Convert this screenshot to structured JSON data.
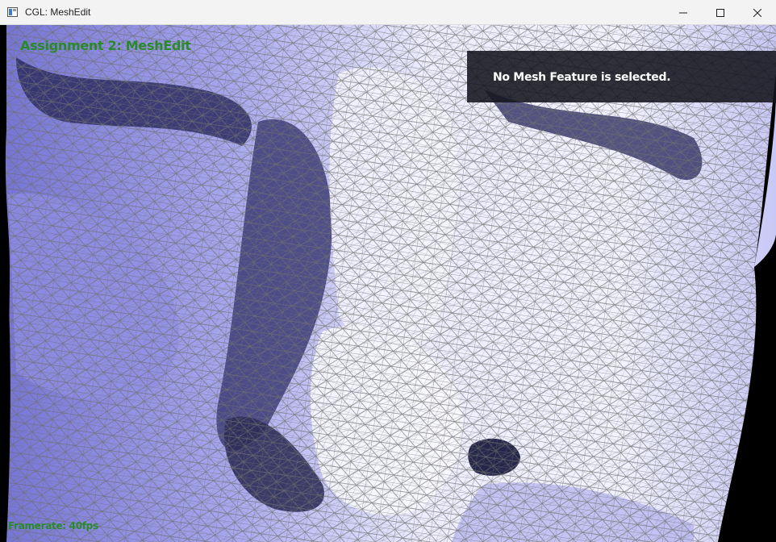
{
  "window": {
    "title": "CGL: MeshEdit",
    "controls": {
      "minimize_icon": "minimize-icon",
      "maximize_icon": "maximize-icon",
      "close_icon": "close-icon"
    }
  },
  "viewport": {
    "heading": "Assignment 2: MeshEdit",
    "info_message": "No Mesh Feature is selected.",
    "framerate": "Framerate: 40fps",
    "colors": {
      "heading": "#2a8a2a",
      "background": "#000000",
      "mesh_light": "#f4f4ff",
      "mesh_mid": "#a8a8f0",
      "mesh_dark": "#3a3a78",
      "wireframe": "#6e6e6e",
      "panel": "#14141e"
    }
  }
}
